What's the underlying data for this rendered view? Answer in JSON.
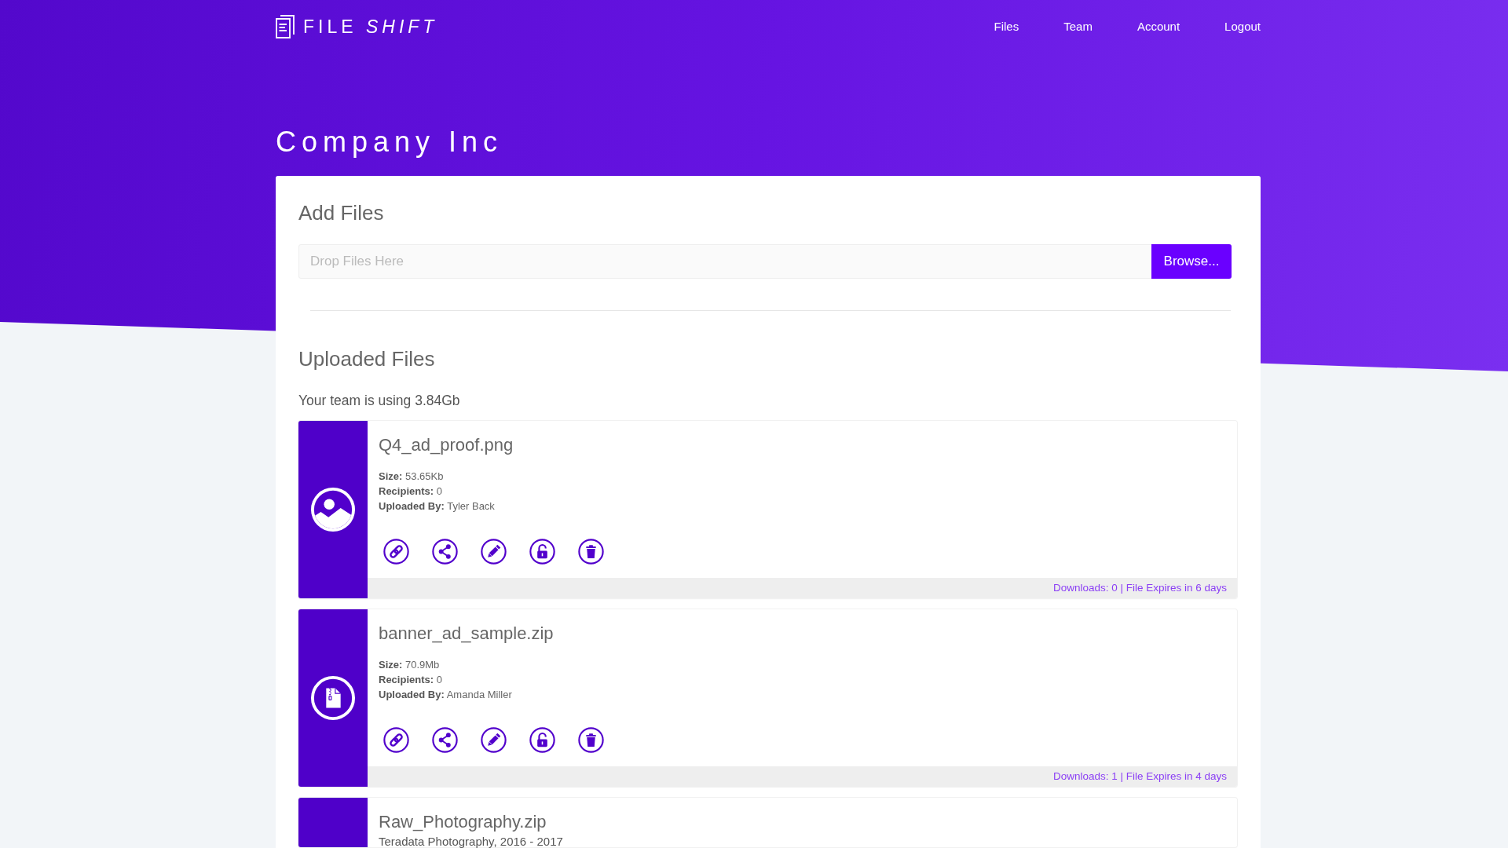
{
  "header": {
    "logo": {
      "text": "FILE *SHIFT*"
    },
    "nav": [
      {
        "label": "Files"
      },
      {
        "label": "Team"
      },
      {
        "label": "Account"
      },
      {
        "label": "Logout"
      }
    ]
  },
  "page_title": "Company Inc",
  "add_files": {
    "heading": "Add Files",
    "drop_field": {
      "placeholder": "Drop Files Here"
    },
    "browse_button": {
      "label": "Browse..."
    }
  },
  "uploaded_files": {
    "heading": "Uploaded Files",
    "usage": "Your team is using 3.84Gb",
    "files": [
      {
        "name": "Q4_ad_proof.png",
        "kind": "image",
        "details": [
          "**Size:** 53.65Kb",
          "**Recipients:** 0",
          "**Uploaded By:** Tyler Back"
        ],
        "footer": "Downloads: 0 | File Expires in 6 days"
      },
      {
        "name": "banner_ad_sample.zip",
        "kind": "archive",
        "details": [
          "**Size:** 70.9Mb",
          "**Recipients:** 0",
          "**Uploaded By:** Amanda Miller"
        ],
        "footer": "Downloads: 1 | File Expires in 4 days"
      },
      {
        "name": "Raw_Photography.zip",
        "description": "Teradata Photography, 2016 - 2017"
      }
    ]
  }
}
